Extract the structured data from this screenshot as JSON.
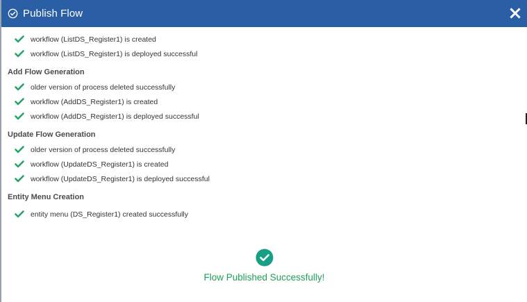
{
  "header": {
    "title": "Publish Flow",
    "title_icon": "check-circle-outline-icon",
    "close_icon": "close-icon",
    "bg_color": "#2a5fa5"
  },
  "sections": [
    {
      "title": "",
      "items": [
        "workflow (ListDS_Register1) is created",
        "workflow (ListDS_Register1) is deployed successful"
      ]
    },
    {
      "title": "Add Flow Generation",
      "items": [
        "older version of process deleted successfully",
        "workflow (AddDS_Register1) is created",
        "workflow (AddDS_Register1) is deployed successful"
      ]
    },
    {
      "title": "Update Flow Generation",
      "items": [
        "older version of process deleted successfully",
        "workflow (UpdateDS_Register1) is created",
        "workflow (UpdateDS_Register1) is deployed successful"
      ]
    },
    {
      "title": "Entity Menu Creation",
      "items": [
        "entity menu (DS_Register1) created successfully"
      ]
    }
  ],
  "result": {
    "message": "Flow Published Successfully!",
    "icon": "success-check-circle-icon",
    "color": "#1e9e5a"
  },
  "colors": {
    "check": "#26a36b",
    "success_circle": "#17a085"
  }
}
